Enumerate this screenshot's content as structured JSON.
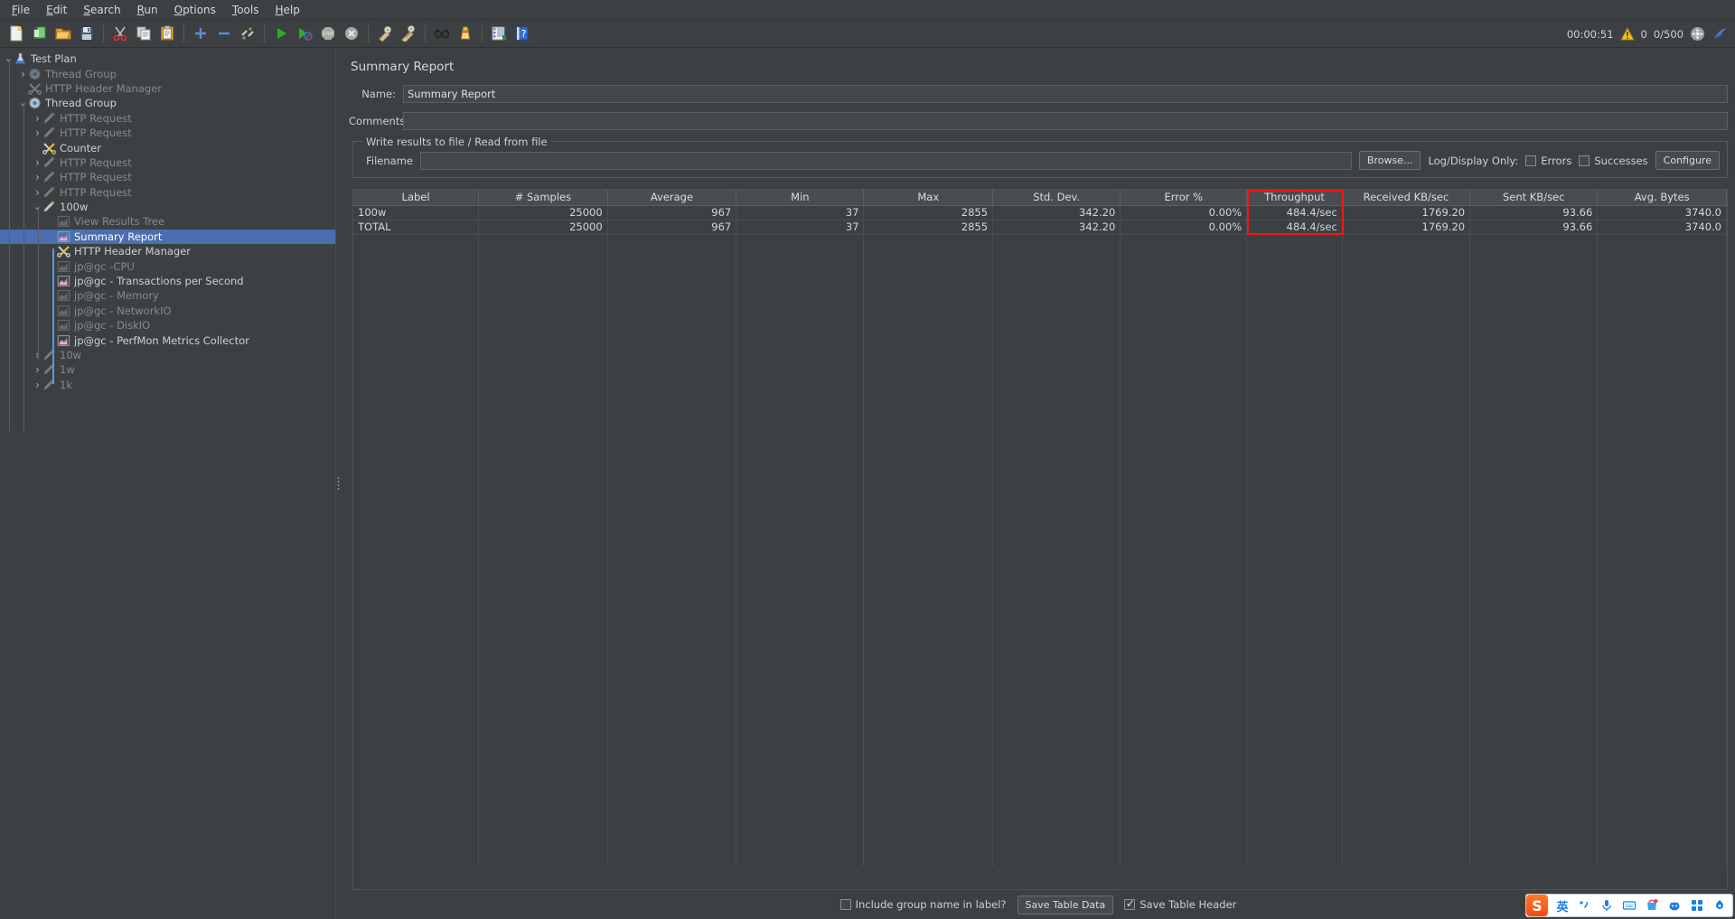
{
  "menubar": {
    "items": [
      {
        "label": "File",
        "mnemonic": "F"
      },
      {
        "label": "Edit",
        "mnemonic": "E"
      },
      {
        "label": "Search",
        "mnemonic": "S"
      },
      {
        "label": "Run",
        "mnemonic": "R"
      },
      {
        "label": "Options",
        "mnemonic": "O"
      },
      {
        "label": "Tools",
        "mnemonic": "T"
      },
      {
        "label": "Help",
        "mnemonic": "H"
      }
    ]
  },
  "toolbar": {
    "buttons": [
      {
        "name": "new-icon",
        "tip": "New"
      },
      {
        "name": "templates-icon",
        "tip": "Templates"
      },
      {
        "name": "open-icon",
        "tip": "Open"
      },
      {
        "name": "save-icon",
        "tip": "Save Test Plan"
      },
      {
        "name": "cut-icon",
        "tip": "Cut"
      },
      {
        "name": "copy-icon",
        "tip": "Copy"
      },
      {
        "name": "paste-icon",
        "tip": "Paste"
      },
      {
        "name": "expand-all-icon",
        "tip": "Expand All"
      },
      {
        "name": "collapse-all-icon",
        "tip": "Collapse All"
      },
      {
        "name": "toggle-icon",
        "tip": "Toggle"
      },
      {
        "name": "start-icon",
        "tip": "Start"
      },
      {
        "name": "start-no-timers-icon",
        "tip": "Start no pauses"
      },
      {
        "name": "stop-icon",
        "tip": "Stop"
      },
      {
        "name": "shutdown-icon",
        "tip": "Shutdown"
      },
      {
        "name": "clear-icon",
        "tip": "Clear"
      },
      {
        "name": "clear-all-icon",
        "tip": "Clear All"
      },
      {
        "name": "search-icon",
        "tip": "Search"
      },
      {
        "name": "reset-search-icon",
        "tip": "Reset Search"
      },
      {
        "name": "function-helper-icon",
        "tip": "Function Helper Dialog"
      },
      {
        "name": "help-icon",
        "tip": "Help"
      }
    ],
    "status": {
      "elapsed": "00:00:51",
      "warning_count": "0",
      "threads": "0/500"
    }
  },
  "tree": {
    "nodes": [
      {
        "label": "Test Plan",
        "indent": 0,
        "twisty": "down",
        "icon": "test-plan-icon",
        "disabled": false,
        "selected": false
      },
      {
        "label": "Thread Group",
        "indent": 1,
        "twisty": "right",
        "icon": "thread-group-icon",
        "disabled": true,
        "selected": false
      },
      {
        "label": "HTTP Header Manager",
        "indent": 1,
        "twisty": "none",
        "icon": "header-manager-icon",
        "disabled": true,
        "selected": false
      },
      {
        "label": "Thread Group",
        "indent": 1,
        "twisty": "down",
        "icon": "thread-group-icon",
        "disabled": false,
        "selected": false
      },
      {
        "label": "HTTP Request",
        "indent": 2,
        "twisty": "right",
        "icon": "http-request-icon",
        "disabled": true,
        "selected": false
      },
      {
        "label": "HTTP Request",
        "indent": 2,
        "twisty": "right",
        "icon": "http-request-icon",
        "disabled": true,
        "selected": false
      },
      {
        "label": "Counter",
        "indent": 2,
        "twisty": "none",
        "icon": "counter-icon",
        "disabled": false,
        "selected": false
      },
      {
        "label": "HTTP Request",
        "indent": 2,
        "twisty": "right",
        "icon": "http-request-icon",
        "disabled": true,
        "selected": false
      },
      {
        "label": "HTTP Request",
        "indent": 2,
        "twisty": "right",
        "icon": "http-request-icon",
        "disabled": true,
        "selected": false
      },
      {
        "label": "HTTP Request",
        "indent": 2,
        "twisty": "right",
        "icon": "http-request-icon",
        "disabled": true,
        "selected": false
      },
      {
        "label": "100w",
        "indent": 2,
        "twisty": "down",
        "icon": "http-request-icon",
        "disabled": false,
        "selected": false
      },
      {
        "label": "View Results Tree",
        "indent": 3,
        "twisty": "none",
        "icon": "listener-icon",
        "disabled": true,
        "selected": false
      },
      {
        "label": "Summary Report",
        "indent": 3,
        "twisty": "none",
        "icon": "listener-icon",
        "disabled": false,
        "selected": true
      },
      {
        "label": "HTTP Header Manager",
        "indent": 3,
        "twisty": "none",
        "icon": "header-manager-icon",
        "disabled": false,
        "selected": false
      },
      {
        "label": "jp@gc -CPU",
        "indent": 3,
        "twisty": "none",
        "icon": "listener-icon",
        "disabled": true,
        "selected": false
      },
      {
        "label": "jp@gc - Transactions per Second",
        "indent": 3,
        "twisty": "none",
        "icon": "listener-icon",
        "disabled": false,
        "selected": false
      },
      {
        "label": "jp@gc - Memory",
        "indent": 3,
        "twisty": "none",
        "icon": "listener-icon",
        "disabled": true,
        "selected": false
      },
      {
        "label": "jp@gc - NetworkIO",
        "indent": 3,
        "twisty": "none",
        "icon": "listener-icon",
        "disabled": true,
        "selected": false
      },
      {
        "label": "jp@gc - DiskIO",
        "indent": 3,
        "twisty": "none",
        "icon": "listener-icon",
        "disabled": true,
        "selected": false
      },
      {
        "label": "jp@gc - PerfMon Metrics Collector",
        "indent": 3,
        "twisty": "none",
        "icon": "listener-icon",
        "disabled": false,
        "selected": false
      },
      {
        "label": "10w",
        "indent": 2,
        "twisty": "right",
        "icon": "http-request-icon",
        "disabled": true,
        "selected": false
      },
      {
        "label": "1w",
        "indent": 2,
        "twisty": "right",
        "icon": "http-request-icon",
        "disabled": true,
        "selected": false
      },
      {
        "label": "1k",
        "indent": 2,
        "twisty": "right",
        "icon": "http-request-icon",
        "disabled": true,
        "selected": false
      }
    ]
  },
  "panel": {
    "title": "Summary Report",
    "name_label": "Name:",
    "name_value": "Summary Report",
    "comments_label": "Comments:",
    "comments_value": "",
    "comments_placeholder": "",
    "group_title": "Write results to file / Read from file",
    "filename_label": "Filename",
    "filename_value": "",
    "browse_label": "Browse...",
    "log_display_label": "Log/Display Only:",
    "errors_label": "Errors",
    "errors_checked": false,
    "successes_label": "Successes",
    "successes_checked": false,
    "configure_label": "Configure"
  },
  "table": {
    "headers": [
      "Label",
      "# Samples",
      "Average",
      "Min",
      "Max",
      "Std. Dev.",
      "Error %",
      "Throughput",
      "Received KB/sec",
      "Sent KB/sec",
      "Avg. Bytes"
    ],
    "rows": [
      [
        "100w",
        "25000",
        "967",
        "37",
        "2855",
        "342.20",
        "0.00%",
        "484.4/sec",
        "1769.20",
        "93.66",
        "3740.0"
      ],
      [
        "TOTAL",
        "25000",
        "967",
        "37",
        "2855",
        "342.20",
        "0.00%",
        "484.4/sec",
        "1769.20",
        "93.66",
        "3740.0"
      ]
    ],
    "highlight": {
      "column": "Throughput",
      "color": "#f01818"
    }
  },
  "bottom": {
    "include_group_label": "Include group name in label?",
    "include_group_checked": false,
    "save_table_data_label": "Save Table Data",
    "save_table_header_label": "Save Table Header",
    "save_table_header_checked": true
  },
  "ime": {
    "logo": "S",
    "mode": "英",
    "items": [
      "punctuation-icon",
      "microphone-icon",
      "keyboard-icon",
      "skin-icon",
      "emoji-icon",
      "apps-icon",
      "settings-icon"
    ]
  }
}
